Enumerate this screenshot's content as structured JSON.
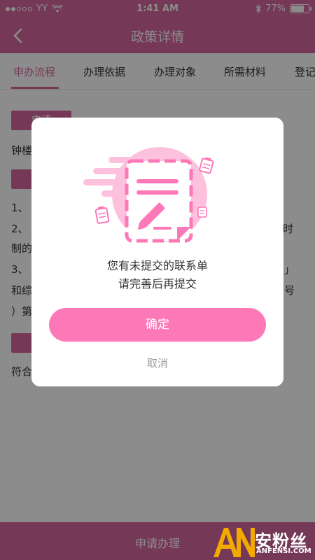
{
  "status_bar": {
    "carrier": "YY",
    "time": "1:41 AM",
    "battery": "77%",
    "battery_level": 0.77,
    "icons": [
      "signal-dots-icon",
      "wifi-icon",
      "bluetooth-icon",
      "battery-icon"
    ]
  },
  "nav": {
    "back_icon": "chevron-left-icon",
    "title": "政策详情"
  },
  "tabs": [
    {
      "label": "申办流程",
      "active": true
    },
    {
      "label": "办理依据",
      "active": false
    },
    {
      "label": "办理对象",
      "active": false
    },
    {
      "label": "所需材料",
      "active": false
    },
    {
      "label": "登记",
      "active": false
    }
  ],
  "content": {
    "section1_head": "申请",
    "line1": "钟楼",
    "line2": "1、",
    "line3": "2、 J",
    "line3_right": "时",
    "line4": "制的",
    "line5": "3、 J",
    "line5_right": "」",
    "line6": "和综",
    "line6_right": "号",
    "line7": "）第",
    "line8": "符合"
  },
  "bottom": {
    "label": "申请办理"
  },
  "dialog": {
    "illustration_icon": "document-edit-icon",
    "message_line1": "您有未提交的联系单",
    "message_line2": "请完善后再提交",
    "confirm_label": "确定",
    "cancel_label": "取消",
    "accent_color": "#fd78b7"
  },
  "watermark": {
    "logo_text": "AN",
    "cn": "安粉丝",
    "en": "ANFENSI.COM"
  },
  "colors": {
    "primary": "#d5689e",
    "button": "#fd78b7"
  }
}
